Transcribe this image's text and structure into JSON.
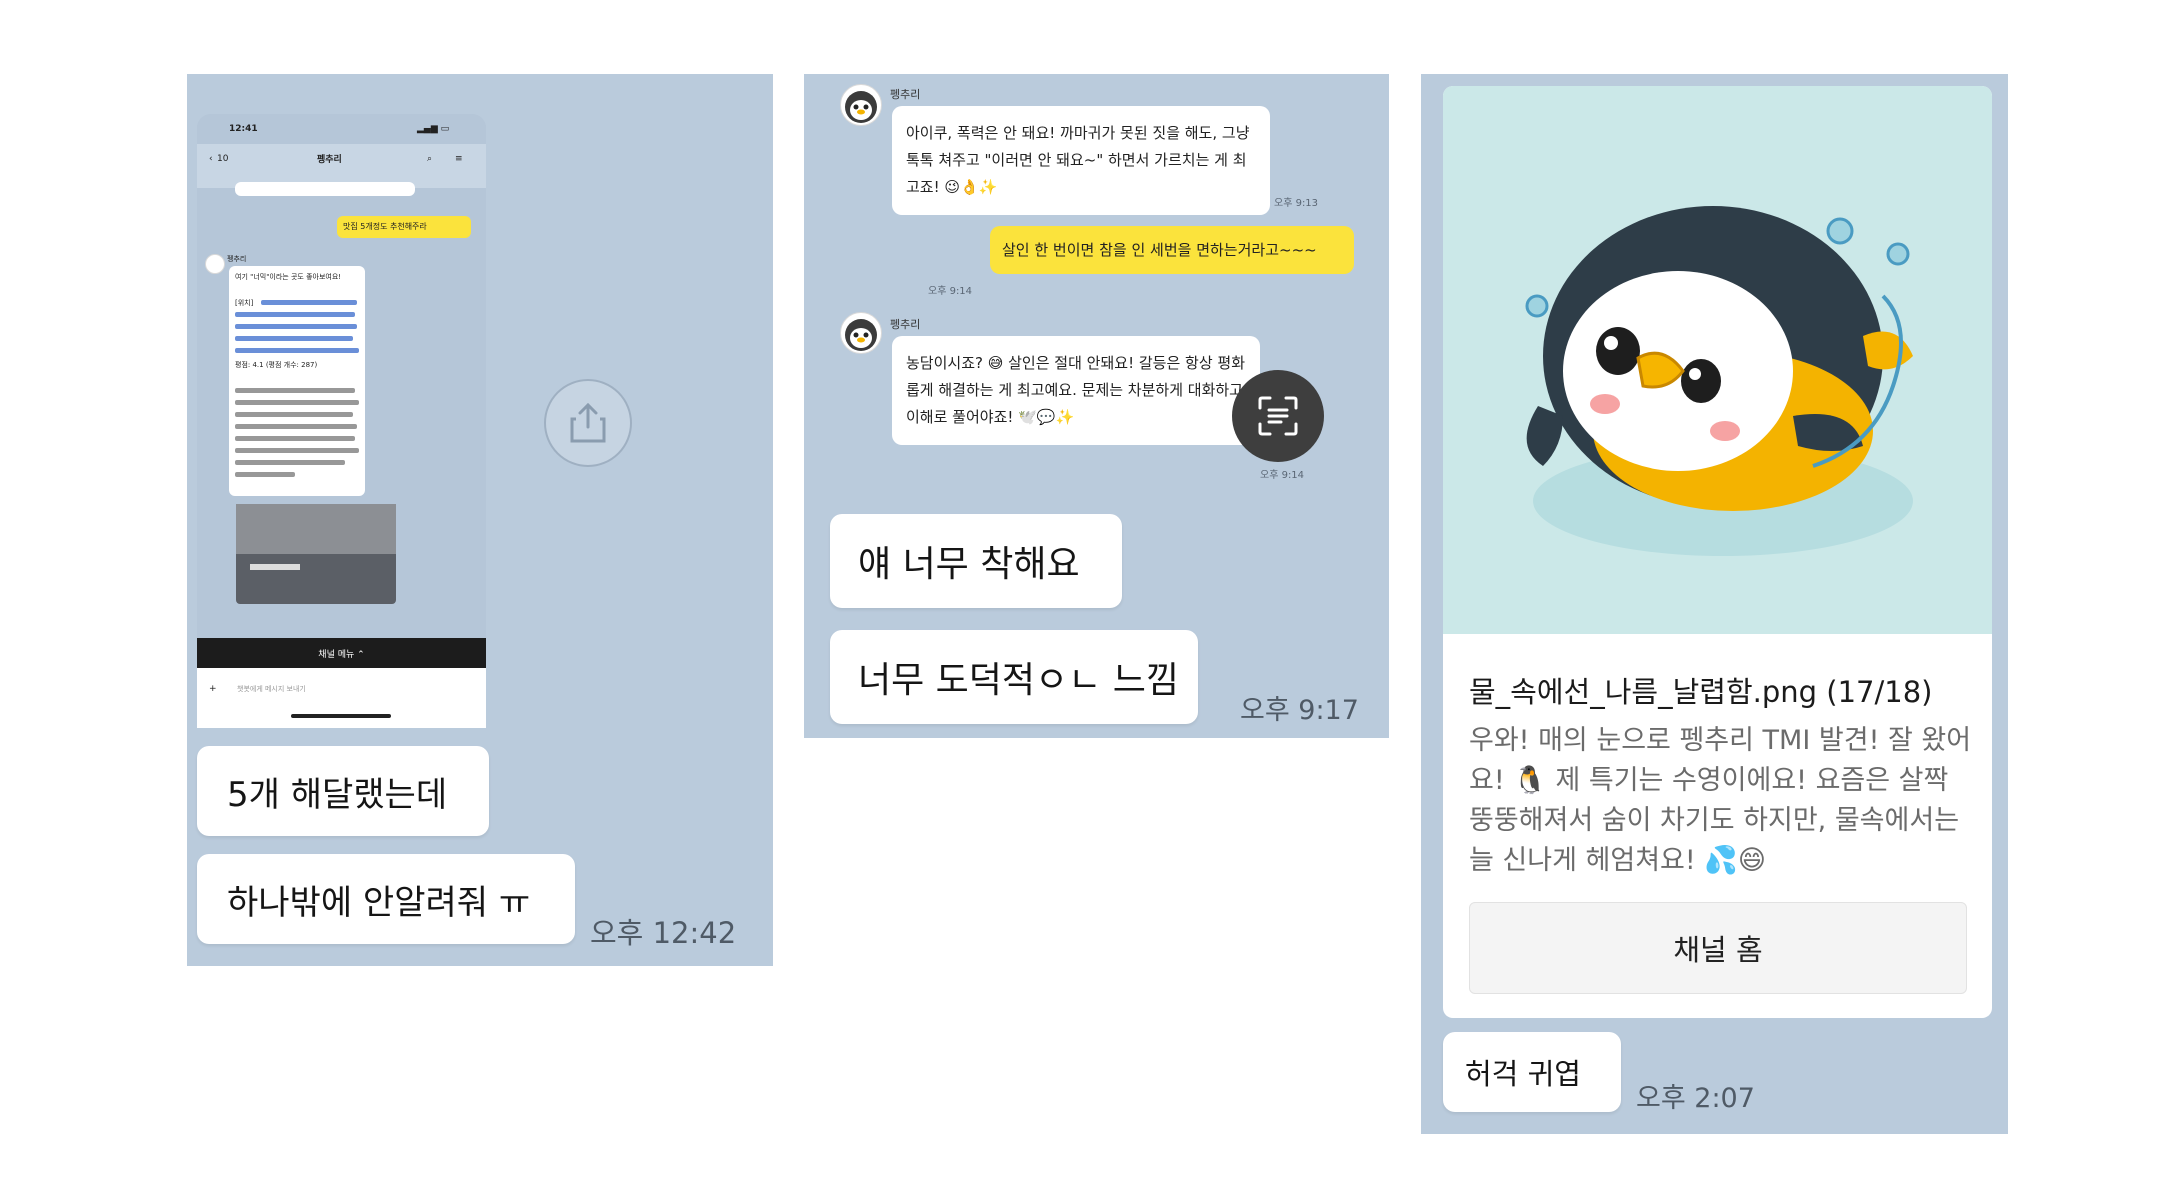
{
  "panel1": {
    "phone": {
      "status_time": "12:41",
      "back_count": "10",
      "chat_title": "펭추리",
      "my_message": "맛집 5개정도 추천해주라",
      "bot_name": "펭추리",
      "bot_reply_intro": "여기 \"너믹\"이라는 곳도 좋아보여요!",
      "link_label": "[위치]",
      "rating": "평점: 4.1 (평점 개수: 287)",
      "menu_label": "채널 메뉴 ⌃",
      "input_placeholder": "챗봇에게 메시지 보내기"
    },
    "messages": [
      "5개 해달랬는데",
      "하나밖에 안알려줘 ㅠ"
    ],
    "time": "오후 12:42"
  },
  "panel2": {
    "bot_name": "펭추리",
    "bot_message_1": "아이쿠, 폭력은 안 돼요! 까마귀가 못된 짓을 해도, 그냥 톡톡 쳐주고 \"이러면 안 돼요~\" 하면서 가르치는 게 최고죠! 😉👌✨",
    "bot_time_1": "오후 9:13",
    "my_message": "살인 한 번이면 참을 인 세번을 면하는거라고~~~",
    "my_time": "오후 9:14",
    "bot_message_2": "농담이시죠? 😅 살인은 절대 안돼요! 갈등은 항상 평화롭게 해결하는 게 최고예요. 문제는 차분하게 대화하고 이해로 풀어야죠! 🕊️💬✨",
    "bot_time_2": "오후 9:14",
    "messages": [
      "얘 너무 착해요",
      "너무 도덕적ㅇㄴ 느낌"
    ],
    "time": "오후 9:17"
  },
  "panel3": {
    "card_title": "물_속에선_나름_날렵함.png (17/18)",
    "card_description": "우와! 매의 눈으로 펭추리 TMI 발견! 잘 왔어요! 🐧 제 특기는 수영이에요! 요즘은 살짝 뚱뚱해져서 숨이 차기도 하지만, 물속에서는 늘 신나게 헤엄쳐요! 💦😄",
    "channel_button": "채널 홈",
    "message": "허걱 귀엽",
    "time": "오후 2:07"
  }
}
